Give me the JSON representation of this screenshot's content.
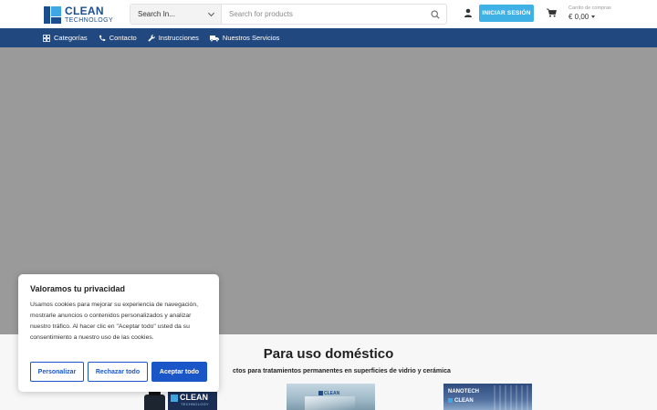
{
  "header": {
    "logo_title": "CLEAN",
    "logo_subtitle": "TECHNOLOGY",
    "search_category": "Search In...",
    "search_placeholder": "Search for products",
    "login_label": "INICIAR SESIÓN",
    "cart_label": "Carrito de compras",
    "cart_amount": "€ 0,00"
  },
  "nav": {
    "items": [
      {
        "label": "Categorías",
        "icon": "grid-icon"
      },
      {
        "label": "Contacto",
        "icon": "phone-icon"
      },
      {
        "label": "Instrucciones",
        "icon": "wrench-icon"
      },
      {
        "label": "Nuestros Servicios",
        "icon": "truck-icon"
      }
    ]
  },
  "section": {
    "title": "Para uso doméstico",
    "subtitle": "ctos para tratamientos permanentes en superficies de vidrio y cerámica"
  },
  "products": [
    {
      "label": "CLEAN",
      "sublabel": "TECHNOLOGY"
    },
    {
      "label": "CLEAN"
    },
    {
      "label": "NANOTECH",
      "sublabel": "CLEAN"
    }
  ],
  "cookie": {
    "title": "Valoramos tu privacidad",
    "text": "Usamos cookies para mejorar su experiencia de navegación, mostrarle anuncios o contenidos personalizados y analizar nuestro tráfico. Al hacer clic en \"Aceptar todo\" usted da su consentimiento a nuestro uso de las cookies.",
    "customize": "Personalizar",
    "reject": "Rechazar todo",
    "accept": "Aceptar todo"
  },
  "colors": {
    "nav_bg": "#22497f",
    "login_bg": "#3fb1e5",
    "hero_bg": "#9a9a9a",
    "cookie_accent": "#1a56c8"
  }
}
